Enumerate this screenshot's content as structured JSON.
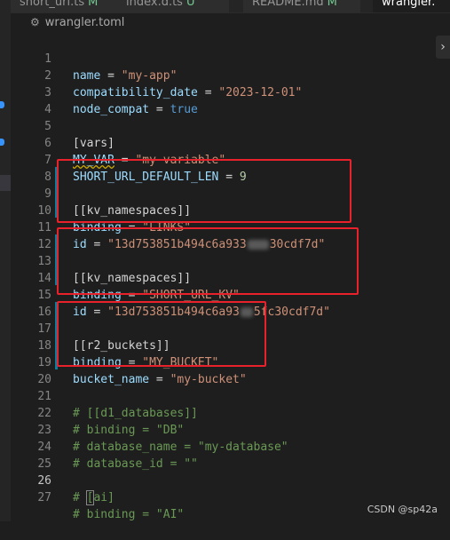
{
  "tabs": [
    {
      "label": "short_url.ts",
      "modified": "M"
    },
    {
      "label": "index.d.ts",
      "modified": "U"
    },
    {
      "label": "README.md",
      "modified": "M"
    },
    {
      "label": "wrangler."
    }
  ],
  "breadcrumb": {
    "file": "wrangler.toml",
    "icon": "gear-icon"
  },
  "editor": {
    "current_line": "26",
    "lines": {
      "l1": {
        "n": "1",
        "key": "name",
        "eq": " = ",
        "val": "\"my-app\""
      },
      "l2": {
        "n": "2",
        "key": "compatibility_date",
        "eq": " = ",
        "val": "\"2023-12-01\""
      },
      "l3": {
        "n": "3",
        "key": "node_compat",
        "eq": " = ",
        "val": "true"
      },
      "l4": {
        "n": "4"
      },
      "l5": {
        "n": "5",
        "text": "[vars]"
      },
      "l6": {
        "n": "6",
        "key": "MY_VAR",
        "eq": " = ",
        "val": "\"my-variable\""
      },
      "l7": {
        "n": "7",
        "key": "SHORT_URL_DEFAULT_LEN",
        "eq": " = ",
        "val": "9"
      },
      "l8": {
        "n": "8"
      },
      "l9": {
        "n": "9",
        "text": "[[kv_namespaces]]"
      },
      "l10": {
        "n": "10",
        "key": "binding",
        "eq": " = ",
        "val": "\"LINKS\""
      },
      "l11": {
        "n": "11",
        "key": "id",
        "eq": " = ",
        "val_a": "\"13d753851b494c6a933",
        "val_b": "30cdf7d\""
      },
      "l12": {
        "n": "12"
      },
      "l13": {
        "n": "13",
        "text": "[[kv_namespaces]]"
      },
      "l14": {
        "n": "14",
        "key": "binding",
        "eq": " = ",
        "val": "\"SHORT_URL_KV\""
      },
      "l15": {
        "n": "15",
        "key": "id",
        "eq": " = ",
        "val_a": "\"13d753851b494c6a93",
        "val_b": "5fc30cdf7d\""
      },
      "l16": {
        "n": "16"
      },
      "l17": {
        "n": "17",
        "text": "[[r2_buckets]]"
      },
      "l18": {
        "n": "18",
        "key": "binding",
        "eq": " = ",
        "val": "\"MY_BUCKET\""
      },
      "l19": {
        "n": "19",
        "key": "bucket_name",
        "eq": " = ",
        "val": "\"my-bucket\""
      },
      "l20": {
        "n": "20"
      },
      "l21": {
        "n": "21",
        "text": "# [[d1_databases]]"
      },
      "l22": {
        "n": "22",
        "text": "# binding = \"DB\""
      },
      "l23": {
        "n": "23",
        "text": "# database_name = \"my-database\""
      },
      "l24": {
        "n": "24",
        "text": "# database_id = \"\""
      },
      "l25": {
        "n": "25"
      },
      "l26": {
        "n": "26",
        "pre": "# ",
        "bracket": "[",
        "rest": "ai]"
      },
      "l27": {
        "n": "27",
        "text": "# binding = \"AI\""
      }
    }
  },
  "collapse_button": {
    "label": "›"
  },
  "watermark": "CSDN @sp42a",
  "colors": {
    "highlight_box": "#e8212b",
    "key": "#9cdcfe",
    "string": "#ce9178",
    "number": "#b5cea8",
    "bool": "#569cd6",
    "comment": "#6a9955"
  }
}
